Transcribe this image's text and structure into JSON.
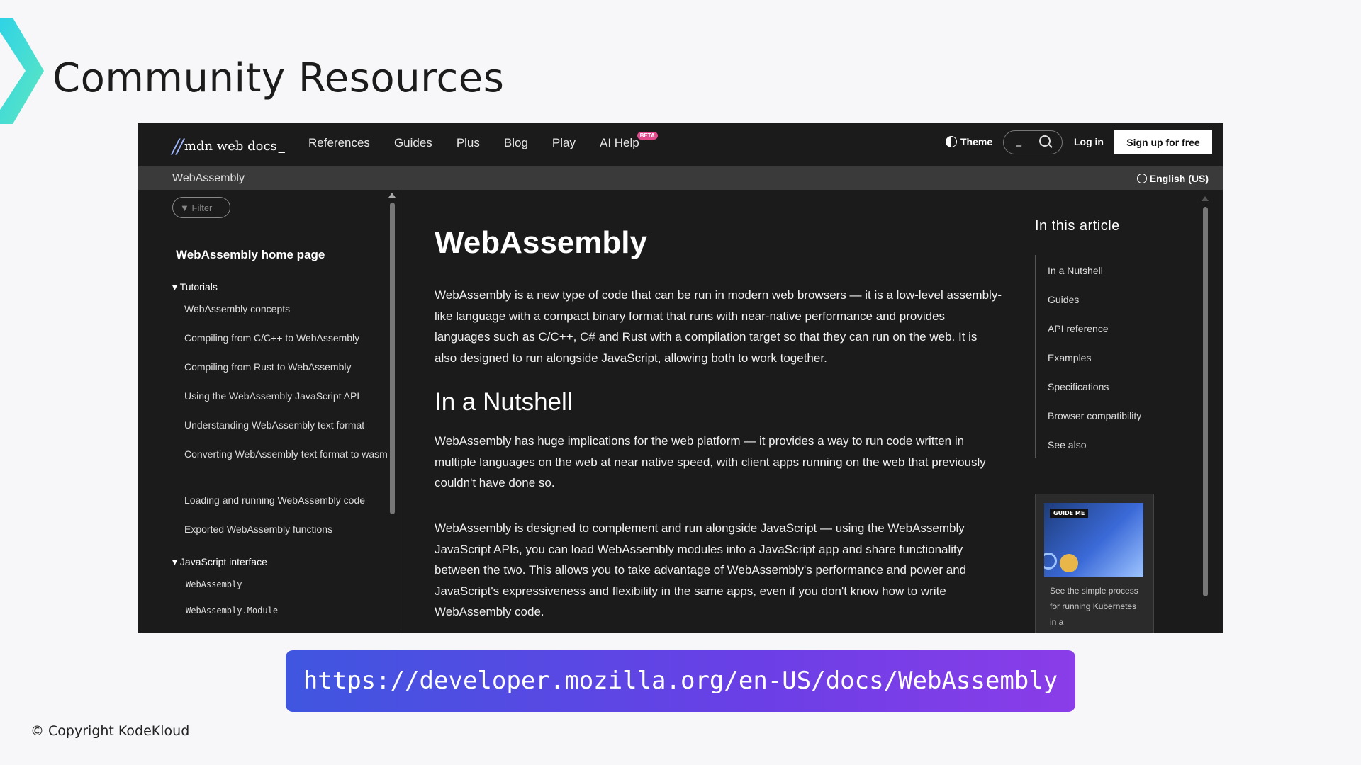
{
  "slide": {
    "title": "Community Resources",
    "url": "https://developer.mozilla.org/en-US/docs/WebAssembly",
    "copyright": "© Copyright KodeKloud"
  },
  "colors": {
    "accent_chevron": "#3fe0d0",
    "url_gradient_start": "#3f56e0",
    "url_gradient_end": "#8a3de8",
    "page_bg": "#1b1b1b"
  },
  "mdn": {
    "logo_text": "mdn web docs",
    "logo_cursor": "_",
    "nav": [
      "References",
      "Guides",
      "Plus",
      "Blog",
      "Play",
      "AI Help"
    ],
    "beta_badge": "BETA",
    "theme_label": "Theme",
    "search_cursor": "_",
    "login_label": "Log in",
    "signup_label": "Sign up for free",
    "breadcrumb": "WebAssembly",
    "language": "English (US)",
    "filter_placeholder": "Filter",
    "sidebar": {
      "home": "WebAssembly home page",
      "group_tutorials": "Tutorials",
      "tutorials": [
        "WebAssembly concepts",
        "Compiling from C/C++ to WebAssembly",
        "Compiling from Rust to WebAssembly",
        "Using the WebAssembly JavaScript API",
        "Understanding WebAssembly text format",
        "Converting WebAssembly text format to wasm",
        "Loading and running WebAssembly code",
        "Exported WebAssembly functions"
      ],
      "group_js": "JavaScript interface",
      "js_items": [
        "WebAssembly",
        "WebAssembly.Module"
      ]
    },
    "article": {
      "h1": "WebAssembly",
      "intro": "WebAssembly is a new type of code that can be run in modern web browsers — it is a low-level assembly-like language with a compact binary format that runs with near-native performance and provides languages such as C/C++, C# and Rust with a compilation target so that they can run on the web. It is also designed to run alongside JavaScript, allowing both to work together.",
      "h2": "In a Nutshell",
      "p2": "WebAssembly has huge implications for the web platform — it provides a way to run code written in multiple languages on the web at near native speed, with client apps running on the web that previously couldn't have done so.",
      "p3": "WebAssembly is designed to complement and run alongside JavaScript — using the WebAssembly JavaScript APIs, you can load WebAssembly modules into a JavaScript app and share functionality between the two. This allows you to take advantage of WebAssembly's performance and power and JavaScript's expressiveness and flexibility in the same apps, even if you don't know how to write WebAssembly code."
    },
    "toc": {
      "title": "In this article",
      "items": [
        "In a Nutshell",
        "Guides",
        "API reference",
        "Examples",
        "Specifications",
        "Browser compatibility",
        "See also"
      ]
    },
    "ad": {
      "badge": "GUIDE ME",
      "text": "See the simple process for running Kubernetes in a"
    }
  }
}
